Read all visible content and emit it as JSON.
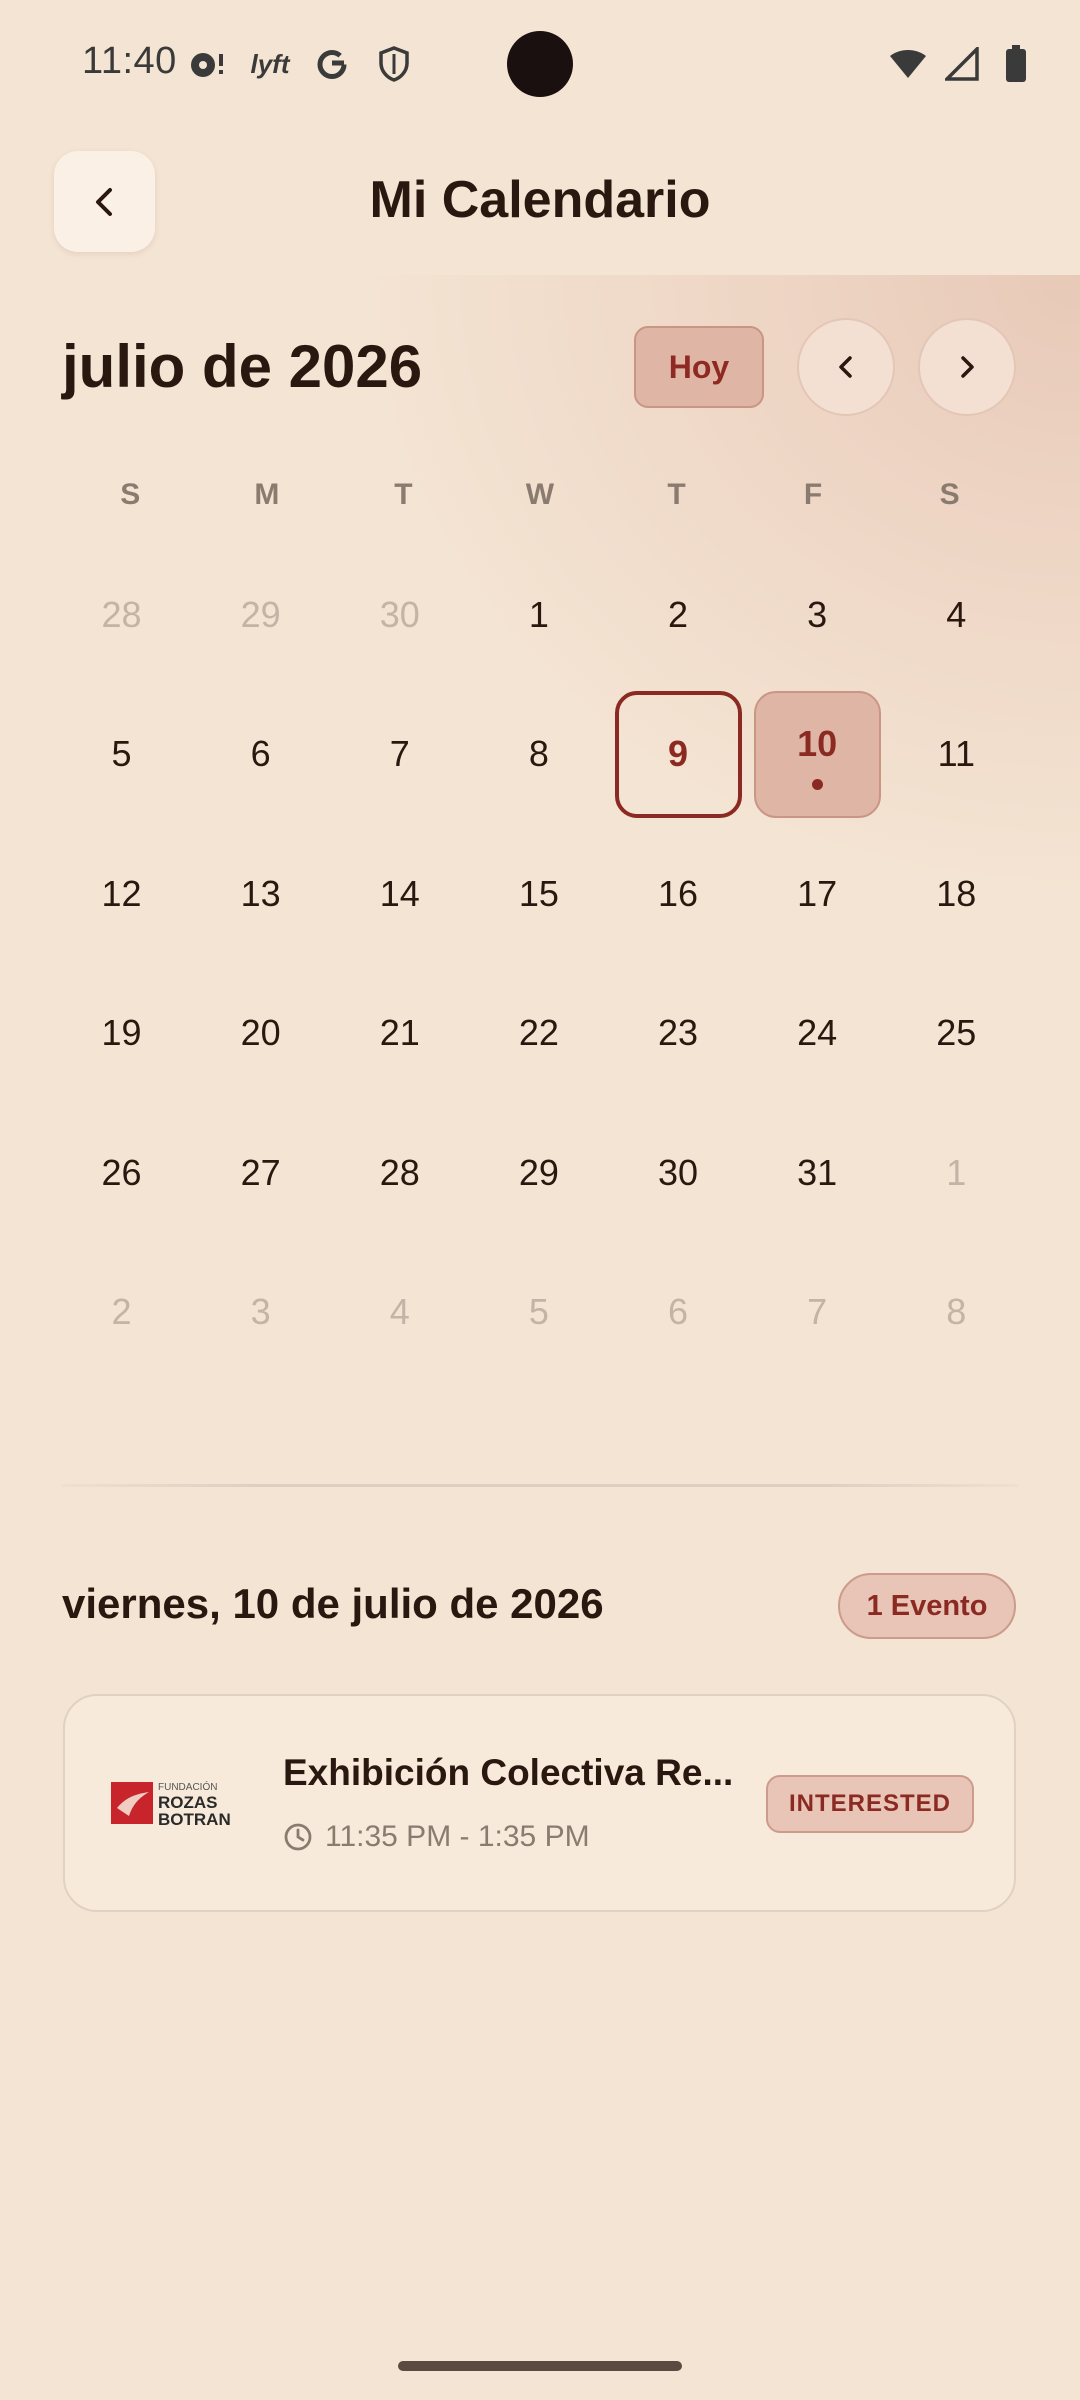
{
  "status_bar": {
    "time": "11:40",
    "icons_left": [
      "notification-dot-icon",
      "lyft-icon",
      "google-icon",
      "shield-icon"
    ],
    "icons_right": [
      "wifi-icon",
      "signal-icon",
      "battery-icon"
    ],
    "lyft_label": "lyft"
  },
  "header": {
    "title": "Mi Calendario",
    "back_icon": "chevron-left-icon"
  },
  "calendar": {
    "month_label": "julio de 2026",
    "today_button": "Hoy",
    "prev_icon": "chevron-left-icon",
    "next_icon": "chevron-right-icon",
    "weekdays": [
      "S",
      "M",
      "T",
      "W",
      "T",
      "F",
      "S"
    ],
    "today_day": "9",
    "selected_day": "10",
    "weeks": [
      [
        {
          "d": "28",
          "m": true
        },
        {
          "d": "29",
          "m": true
        },
        {
          "d": "30",
          "m": true
        },
        {
          "d": "1"
        },
        {
          "d": "2"
        },
        {
          "d": "3"
        },
        {
          "d": "4"
        }
      ],
      [
        {
          "d": "5"
        },
        {
          "d": "6"
        },
        {
          "d": "7"
        },
        {
          "d": "8"
        },
        {
          "d": "9",
          "today": true
        },
        {
          "d": "10",
          "selected": true,
          "event": true
        },
        {
          "d": "11"
        }
      ],
      [
        {
          "d": "12"
        },
        {
          "d": "13"
        },
        {
          "d": "14"
        },
        {
          "d": "15"
        },
        {
          "d": "16"
        },
        {
          "d": "17"
        },
        {
          "d": "18"
        }
      ],
      [
        {
          "d": "19"
        },
        {
          "d": "20"
        },
        {
          "d": "21"
        },
        {
          "d": "22"
        },
        {
          "d": "23"
        },
        {
          "d": "24"
        },
        {
          "d": "25"
        }
      ],
      [
        {
          "d": "26"
        },
        {
          "d": "27"
        },
        {
          "d": "28"
        },
        {
          "d": "29"
        },
        {
          "d": "30"
        },
        {
          "d": "31"
        },
        {
          "d": "1",
          "m": true
        }
      ],
      [
        {
          "d": "2",
          "m": true
        },
        {
          "d": "3",
          "m": true
        },
        {
          "d": "4",
          "m": true
        },
        {
          "d": "5",
          "m": true
        },
        {
          "d": "6",
          "m": true
        },
        {
          "d": "7",
          "m": true
        },
        {
          "d": "8",
          "m": true
        }
      ]
    ]
  },
  "selected_date": {
    "title": "viernes, 10 de julio de 2026",
    "event_count": "1 Evento"
  },
  "events": [
    {
      "title": "Exhibición Colectiva Re...",
      "time": "11:35 PM - 1:35 PM",
      "status": "INTERESTED",
      "logo_text": [
        "FUNDACIÓN",
        "ROZAS",
        "BOTRAN"
      ]
    }
  ],
  "colors": {
    "background": "#f4e4d3",
    "accent": "#8b2a22",
    "accent_soft": "#dfb5a5",
    "text": "#2a1810",
    "muted": "#c4b3a6"
  }
}
